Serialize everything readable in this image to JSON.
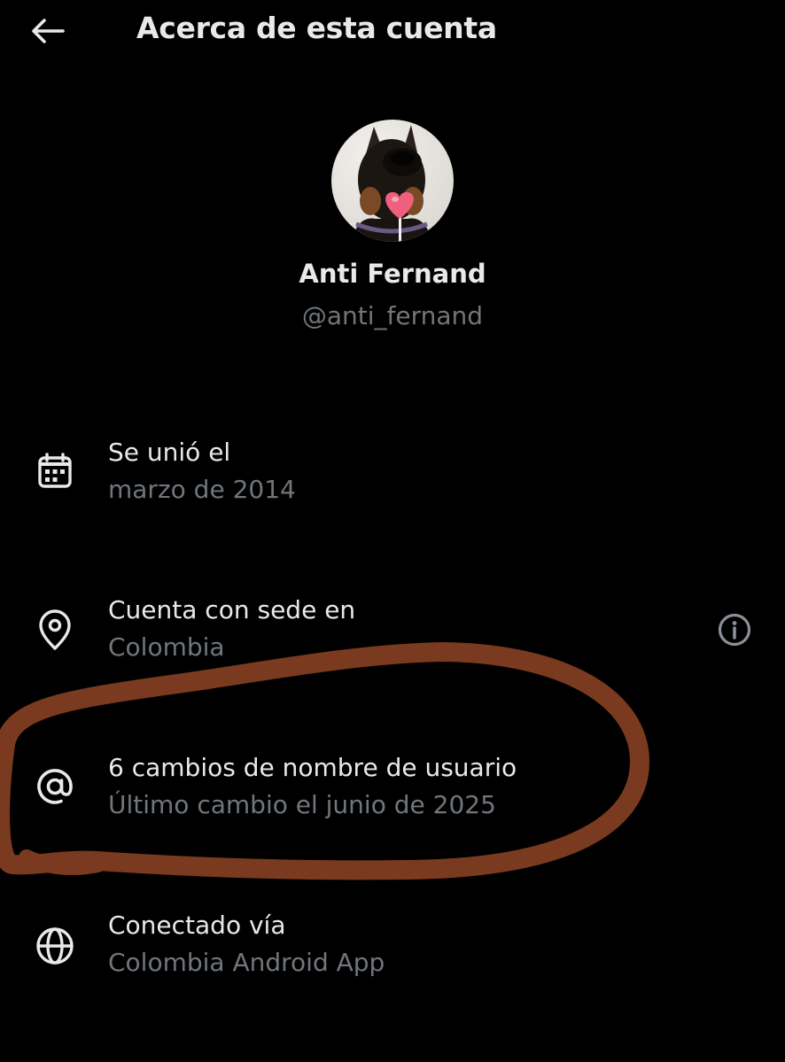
{
  "header": {
    "title": "Acerca de esta cuenta",
    "back_icon": "arrow-left-icon"
  },
  "profile": {
    "display_name": "Anti Fernand",
    "handle": "@anti_fernand"
  },
  "details": [
    {
      "icon": "calendar-icon",
      "label": "Se unió el",
      "value": "marzo de 2014"
    },
    {
      "icon": "location-pin-icon",
      "label": "Cuenta con sede en",
      "value": "Colombia",
      "info_icon": "info-icon"
    },
    {
      "icon": "at-sign-icon",
      "label": "6 cambios de nombre de usuario",
      "value": "Último cambio el junio de 2025"
    },
    {
      "icon": "globe-icon",
      "label": "Conectado vía",
      "value": "Colombia Android App"
    }
  ],
  "colors": {
    "background": "#000000",
    "primary_text": "#e7e9ea",
    "secondary_text": "#71767b",
    "highlight_stroke": "#7a3a1f"
  }
}
